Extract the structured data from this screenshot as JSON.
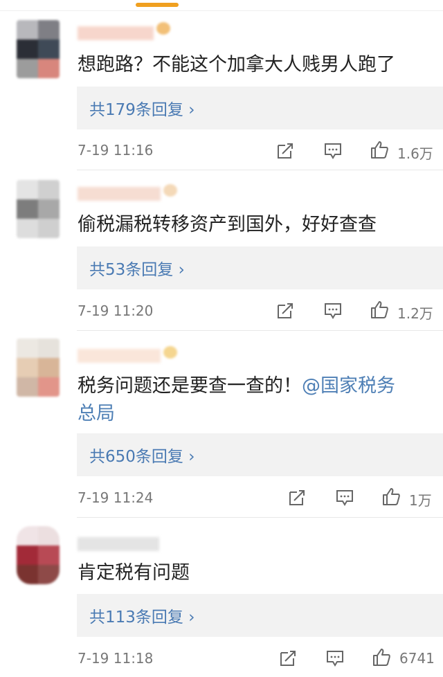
{
  "comments": [
    {
      "text": "想跑路？不能这个加拿大人贱男人跑了",
      "replies_label": "共179条回复 ›",
      "time": "7-19 11:16",
      "likes": "1.6万"
    },
    {
      "text": "偷税漏税转移资产到国外，好好查查",
      "replies_label": "共53条回复 ›",
      "time": "7-19 11:20",
      "likes": "1.2万"
    },
    {
      "text": "税务问题还是要查一查的！",
      "mention": "@国家税务",
      "text_line2": "总局",
      "replies_label": "共650条回复 ›",
      "time": "7-19 11:24",
      "likes": "1万"
    },
    {
      "text": "肯定税有问题",
      "replies_label": "共113条回复 ›",
      "time": "7-19 11:18",
      "likes": "6741"
    }
  ],
  "icons": {
    "share": "share-icon",
    "comment": "comment-icon",
    "like": "thumbs-up-icon"
  },
  "colors": {
    "accent": "#f0a020",
    "link": "#4a7ab3",
    "reply_bg": "#f2f2f2",
    "meta": "#777777"
  }
}
